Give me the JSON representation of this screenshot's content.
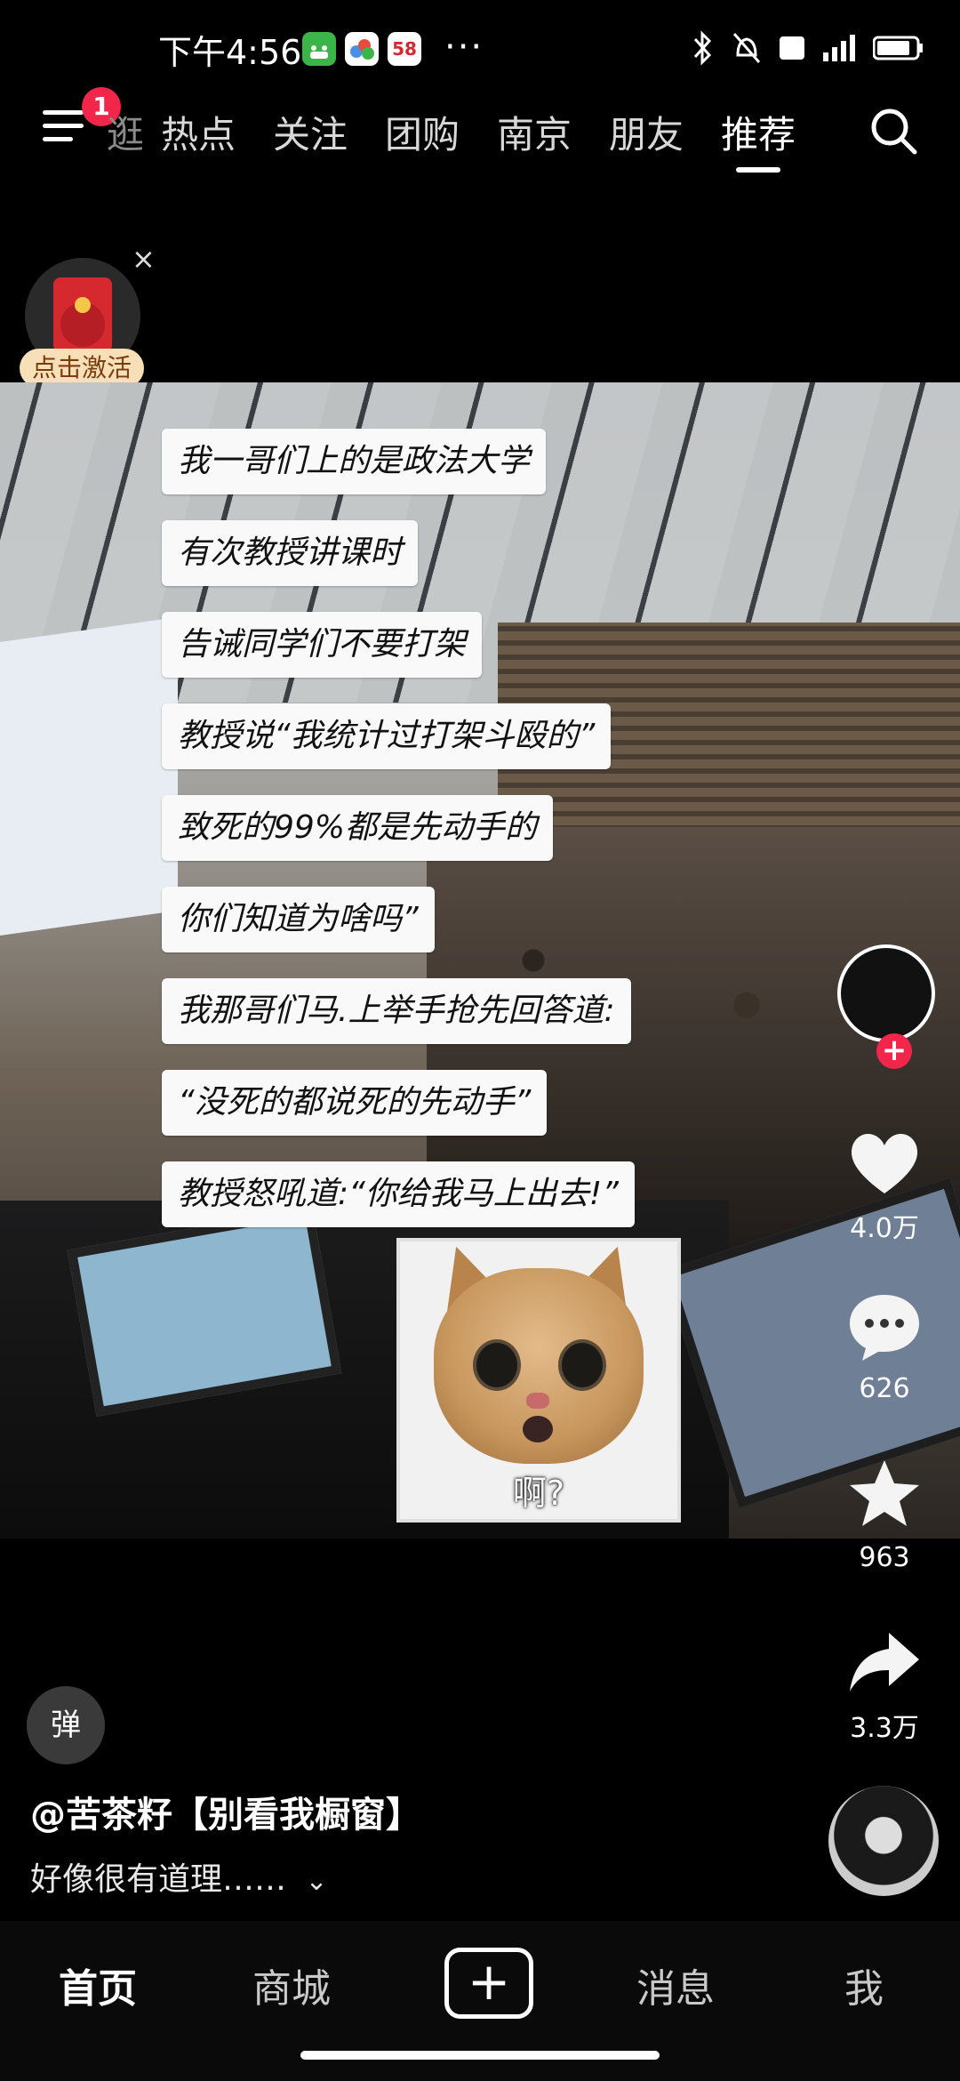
{
  "status_bar": {
    "time": "下午4:56",
    "more": "···",
    "app_icons": [
      {
        "name": "android-app-icon",
        "color": "#3bb54a"
      },
      {
        "name": "cloud-app-icon",
        "color": "#ffffff"
      },
      {
        "name": "app-58-icon",
        "color": "#ffffff",
        "text": "58"
      }
    ],
    "right_icons": [
      "bluetooth-icon",
      "mute-bell-icon",
      "hd-icon",
      "signal-icon",
      "battery-icon"
    ]
  },
  "top_nav": {
    "notification_badge": "1",
    "tabs": [
      {
        "label": "逛",
        "partial": true
      },
      {
        "label": "热点"
      },
      {
        "label": "关注"
      },
      {
        "label": "团购"
      },
      {
        "label": "南京"
      },
      {
        "label": "朋友"
      },
      {
        "label": "推荐",
        "active": true
      }
    ],
    "search_icon": "search-icon"
  },
  "red_envelope": {
    "label": "点击激活",
    "close": "×"
  },
  "video": {
    "captions": [
      "我一哥们上的是政法大学",
      "有次教授讲课时",
      "告诫同学们不要打架",
      "教授说“我统计过打架斗殴的”",
      "致死的99%都是先动手的",
      "你们知道为啥吗”",
      "我那哥们马.上举手抢先回答道:",
      "“没死的都说死的先动手”",
      "教授怒吼道:“你给我马上出去!”"
    ],
    "sticker_text": "啊?"
  },
  "right_rail": {
    "like_count": "4.0万",
    "comment_count": "626",
    "favorite_count": "963",
    "share_count": "3.3万"
  },
  "info": {
    "danmu_label": "弹",
    "username": "@苦茶籽【别看我橱窗】",
    "description": "好像很有道理……",
    "expand_icon": "chevron-down-icon"
  },
  "bottom_nav": {
    "home": "首页",
    "mall": "商城",
    "create": "+",
    "messages": "消息",
    "me": "我"
  },
  "colors": {
    "accent_red": "#f2254a",
    "background": "#000000",
    "envelope_red": "#d6282f"
  }
}
